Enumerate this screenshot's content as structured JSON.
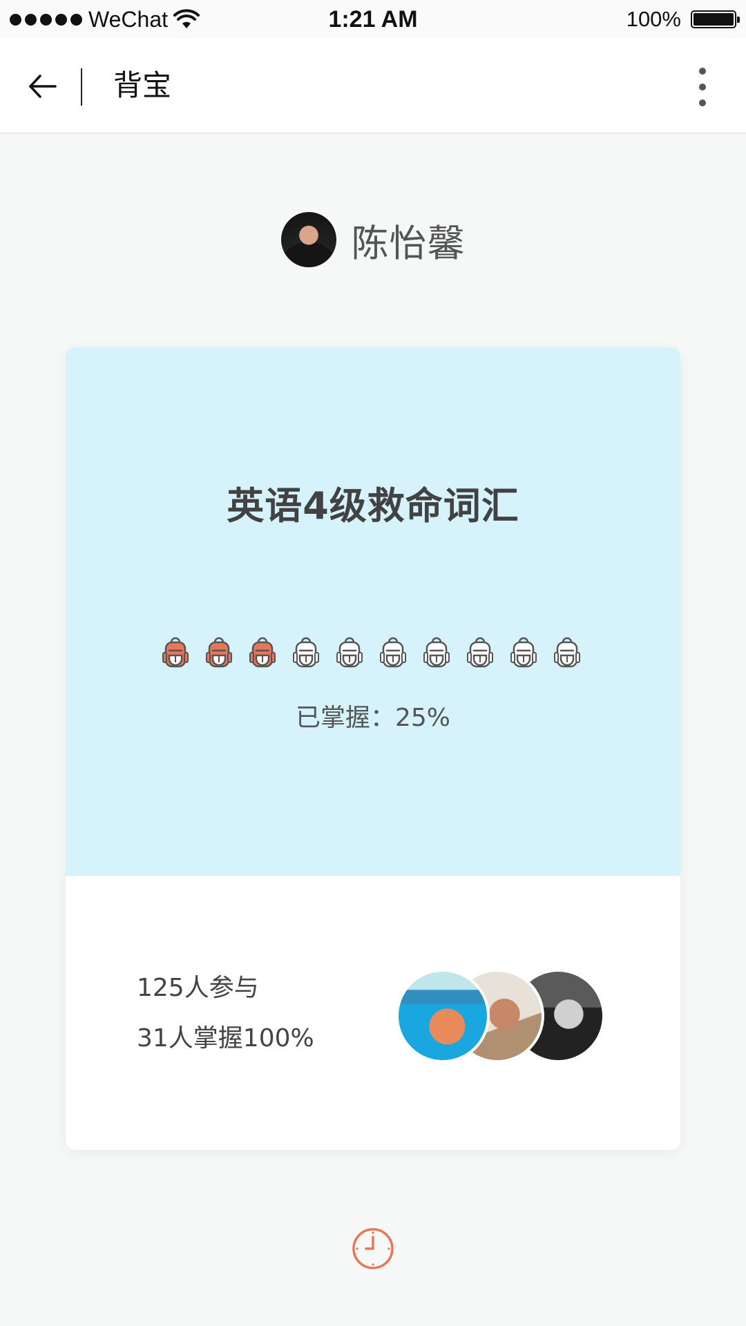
{
  "status_bar": {
    "carrier": "WeChat",
    "time": "1:21 AM",
    "battery": "100%"
  },
  "nav": {
    "title": "背宝",
    "back_icon": "arrow-left-icon",
    "more_icon": "vertical-dots-icon"
  },
  "user": {
    "name": "陈怡馨"
  },
  "card": {
    "title": "英语4级救命词汇",
    "progress": {
      "total_icons": 10,
      "filled_icons": 3,
      "label": "已掌握：25%",
      "percent": 25
    },
    "stats": {
      "participants": "125人参与",
      "mastered": "31人掌握100%"
    },
    "participant_avatar_count": 3
  },
  "footer": {
    "icon": "clock-icon"
  },
  "colors": {
    "accent": "#e8775a",
    "card_top_bg": "#d6f3fb",
    "page_bg": "#f6f7f7"
  }
}
